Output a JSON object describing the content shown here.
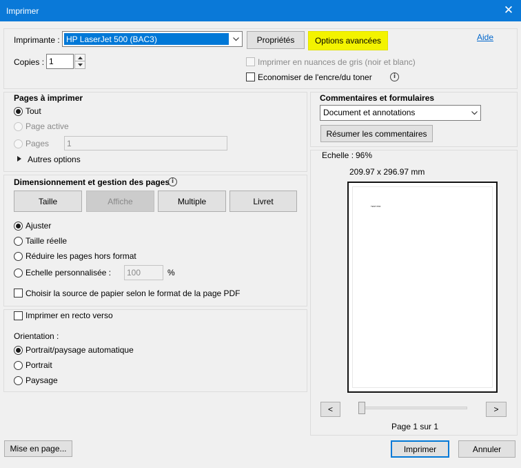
{
  "window": {
    "title": "Imprimer",
    "close_glyph": "✕"
  },
  "help_link": "Aide",
  "printer": {
    "label": "Imprimante :",
    "selected": "HP LaserJet 500 (BAC3)",
    "properties_button": "Propriétés",
    "advanced_button": "Options avancées",
    "copies_label": "Copies :",
    "copies_value": "1",
    "grayscale_label": "Imprimer en nuances de gris (noir et blanc)",
    "save_ink_label": "Economiser de l'encre/du toner"
  },
  "pages": {
    "heading": "Pages à imprimer",
    "all": "Tout",
    "current": "Page active",
    "pages": "Pages",
    "pages_value": "1",
    "more_options": "Autres options"
  },
  "sizing": {
    "heading": "Dimensionnement et gestion des pages",
    "tabs": [
      "Taille",
      "Affiche",
      "Multiple",
      "Livret"
    ],
    "fit": "Ajuster",
    "actual_size": "Taille réelle",
    "shrink": "Réduire les pages hors format",
    "custom_scale": "Echelle personnalisée :",
    "custom_scale_value": "100",
    "percent": "%",
    "paper_source": "Choisir la source de papier selon le format de la page PDF"
  },
  "duplex": {
    "label": "Imprimer en recto verso"
  },
  "orientation": {
    "label": "Orientation :",
    "auto": "Portrait/paysage automatique",
    "portrait": "Portrait",
    "landscape": "Paysage"
  },
  "comments": {
    "heading": "Commentaires et formulaires",
    "selected": "Document et annotations",
    "summarize_button": "Résumer les commentaires"
  },
  "preview": {
    "scale_label": "Echelle :",
    "scale_value": "96%",
    "dimensions": "209.97 x 296.97 mm",
    "page_text": "TEST PDF",
    "prev": "<",
    "next": ">",
    "page_indicator": "Page 1 sur 1",
    "slider_position": 0
  },
  "footer": {
    "page_setup_button": "Mise en page...",
    "print_button": "Imprimer",
    "cancel_button": "Annuler"
  },
  "colors": {
    "accent": "#0078d7",
    "highlight": "#f3f300",
    "selection": "#0078d7"
  }
}
